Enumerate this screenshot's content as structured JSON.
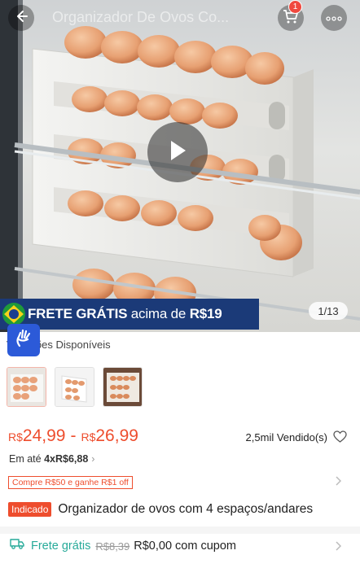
{
  "header": {
    "title": "Organizador De Ovos Co...",
    "cart_count": "1"
  },
  "media": {
    "counter": "1/13",
    "banner": {
      "prefix": "FRETE GRÁTIS",
      "middle": " acima de ",
      "amount": "R$19"
    }
  },
  "variations": {
    "label": "Variações Disponíveis",
    "thumbnails": [
      "variant-1",
      "variant-2",
      "variant-3"
    ]
  },
  "price": {
    "currency": "R$",
    "min": "24,99",
    "max": "26,99",
    "separator": "-",
    "sold": "2,5mil Vendido(s)"
  },
  "installment": {
    "prefix": "Em até ",
    "value": "4xR$6,88",
    "chevron": "›"
  },
  "promo": {
    "tag": "Compre R$50 e ganhe R$1 off"
  },
  "product": {
    "badge": "Indicado",
    "title": "Organizador de ovos com 4 espaços/andares"
  },
  "shipping": {
    "label": "Frete grátis",
    "old_price": "R$8,39",
    "new_price": "R$0,00 com cupom"
  },
  "colors": {
    "accent": "#ee4d2d",
    "shipping_green": "#26aa99",
    "banner_blue": "#1b3a78"
  }
}
